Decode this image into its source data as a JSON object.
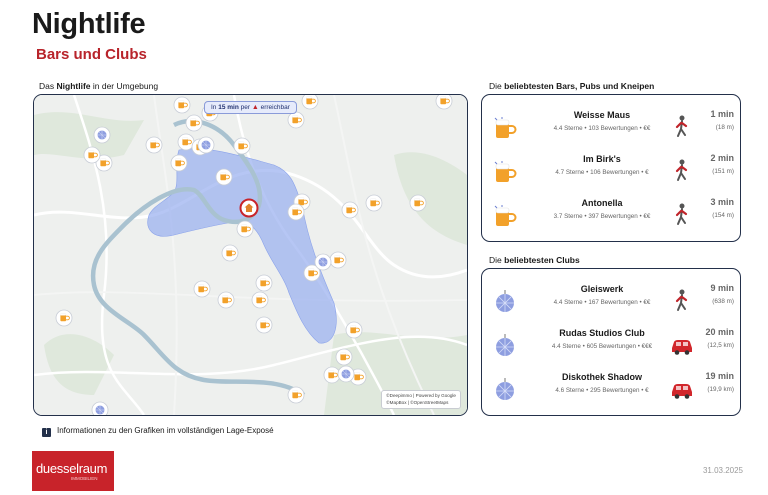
{
  "header": {
    "title": "Nightlife",
    "subtitle": "Bars und Clubs"
  },
  "map": {
    "caption_prefix": "Das",
    "caption_bold": "Nightlife",
    "caption_suffix": "in der Umgebung",
    "reach_prefix": "In",
    "reach_bold": "15 min",
    "reach_mid": "per",
    "reach_suffix": "erreichbar",
    "attribution_line1": "©Deepimmo | Powered by Google",
    "attribution_line2": "©MapBox | ©OpenStreetMaps",
    "icons": {
      "bar": "beer-mug-icon",
      "club": "disco-ball-icon",
      "home": "home-marker-icon"
    },
    "colors": {
      "reach_area": "#97aef0",
      "river": "#a9c2d0",
      "road": "#ffffff",
      "green": "#dfe8dc"
    }
  },
  "bars_section": {
    "caption_prefix": "Die",
    "caption_bold": "beliebtesten Bars, Pubs und Kneipen",
    "items": [
      {
        "name": "Weisse Maus",
        "meta": "4.4 Sterne • 103 Bewertungen • €€",
        "mode_icon": "walking-icon",
        "time": "1 min",
        "dist": "(18 m)"
      },
      {
        "name": "Im Birk's",
        "meta": "4.7 Sterne • 106 Bewertungen • €",
        "mode_icon": "walking-icon",
        "time": "2 min",
        "dist": "(151 m)"
      },
      {
        "name": "Antonella",
        "meta": "3.7 Sterne • 397 Bewertungen • €€",
        "mode_icon": "walking-icon",
        "time": "3 min",
        "dist": "(154 m)"
      }
    ]
  },
  "clubs_section": {
    "caption_prefix": "Die",
    "caption_bold": "beliebtesten Clubs",
    "items": [
      {
        "name": "Gleiswerk",
        "meta": "4.4 Sterne • 167 Bewertungen • €€",
        "mode_icon": "walking-icon",
        "time": "9 min",
        "dist": "(638 m)"
      },
      {
        "name": "Rudas Studios Club",
        "meta": "4.4 Sterne • 605 Bewertungen • €€€",
        "mode_icon": "car-icon",
        "time": "20 min",
        "dist": "(12,5 km)"
      },
      {
        "name": "Diskothek Shadow",
        "meta": "4.6 Sterne • 295 Bewertungen • €",
        "mode_icon": "car-icon",
        "time": "19 min",
        "dist": "(19,9 km)"
      }
    ]
  },
  "footer": {
    "info": "Informationen zu den Grafiken im vollständigen Lage-Exposé",
    "logo_brand": "duesselraum",
    "logo_tag": "IMMOBILIEN",
    "date": "31.03.2025"
  },
  "colors": {
    "accent": "#b8242b",
    "border": "#23304a",
    "walk": "#c0242a",
    "car": "#d1262b"
  }
}
